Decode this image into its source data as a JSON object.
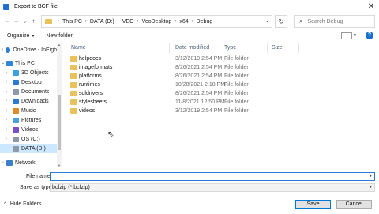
{
  "window": {
    "title": "Export to BCF file"
  },
  "nav": {
    "breadcrumbs": [
      "This PC",
      "DATA (D:)",
      "VEO",
      "VeoDesktop",
      "x64",
      "Debug"
    ],
    "search_placeholder": "Search Debug"
  },
  "toolbar": {
    "organize_label": "Organize",
    "new_folder_label": "New folder"
  },
  "sidebar": {
    "items": [
      {
        "label": "OneDrive - InEigh",
        "icon": "onedrive-icon"
      },
      {
        "label": "This PC",
        "icon": "computer-icon"
      },
      {
        "label": "3D Objects",
        "icon": "3d-objects-icon"
      },
      {
        "label": "Desktop",
        "icon": "desktop-icon"
      },
      {
        "label": "Documents",
        "icon": "documents-icon"
      },
      {
        "label": "Downloads",
        "icon": "downloads-icon"
      },
      {
        "label": "Music",
        "icon": "music-icon"
      },
      {
        "label": "Pictures",
        "icon": "pictures-icon"
      },
      {
        "label": "Videos",
        "icon": "videos-icon"
      },
      {
        "label": "OS (C:)",
        "icon": "drive-icon"
      },
      {
        "label": "DATA (D:)",
        "icon": "drive-icon"
      },
      {
        "label": "Network",
        "icon": "network-icon"
      }
    ]
  },
  "filelist": {
    "columns": [
      "Name",
      "Date modified",
      "Type",
      "Size"
    ],
    "rows": [
      {
        "name": "helpdocs",
        "date": "3/12/2019 2:54 PM",
        "type": "File folder"
      },
      {
        "name": "imageformats",
        "date": "8/26/2021 2:54 PM",
        "type": "File folder"
      },
      {
        "name": "platforms",
        "date": "8/26/2021 2:54 PM",
        "type": "File folder"
      },
      {
        "name": "runtimes",
        "date": "10/28/2021 2:18 PM",
        "type": "File folder"
      },
      {
        "name": "sqldrivers",
        "date": "8/26/2021 2:54 PM",
        "type": "File folder"
      },
      {
        "name": "stylesheets",
        "date": "11/8/2021 12:50 PM",
        "type": "File folder"
      },
      {
        "name": "videos",
        "date": "3/12/2019 2:54 PM",
        "type": "File folder"
      }
    ]
  },
  "footer": {
    "file_name_label": "File name:",
    "file_name_value": "",
    "save_type_label": "Save as type:",
    "save_type_value": "bcfzip (*.bcfzip)",
    "hide_folders_label": "Hide Folders",
    "save_label": "Save",
    "cancel_label": "Cancel"
  },
  "colors": {
    "accent": "#0078d7",
    "folder": "#e9c25c",
    "selected_bg": "#cce8ff"
  }
}
